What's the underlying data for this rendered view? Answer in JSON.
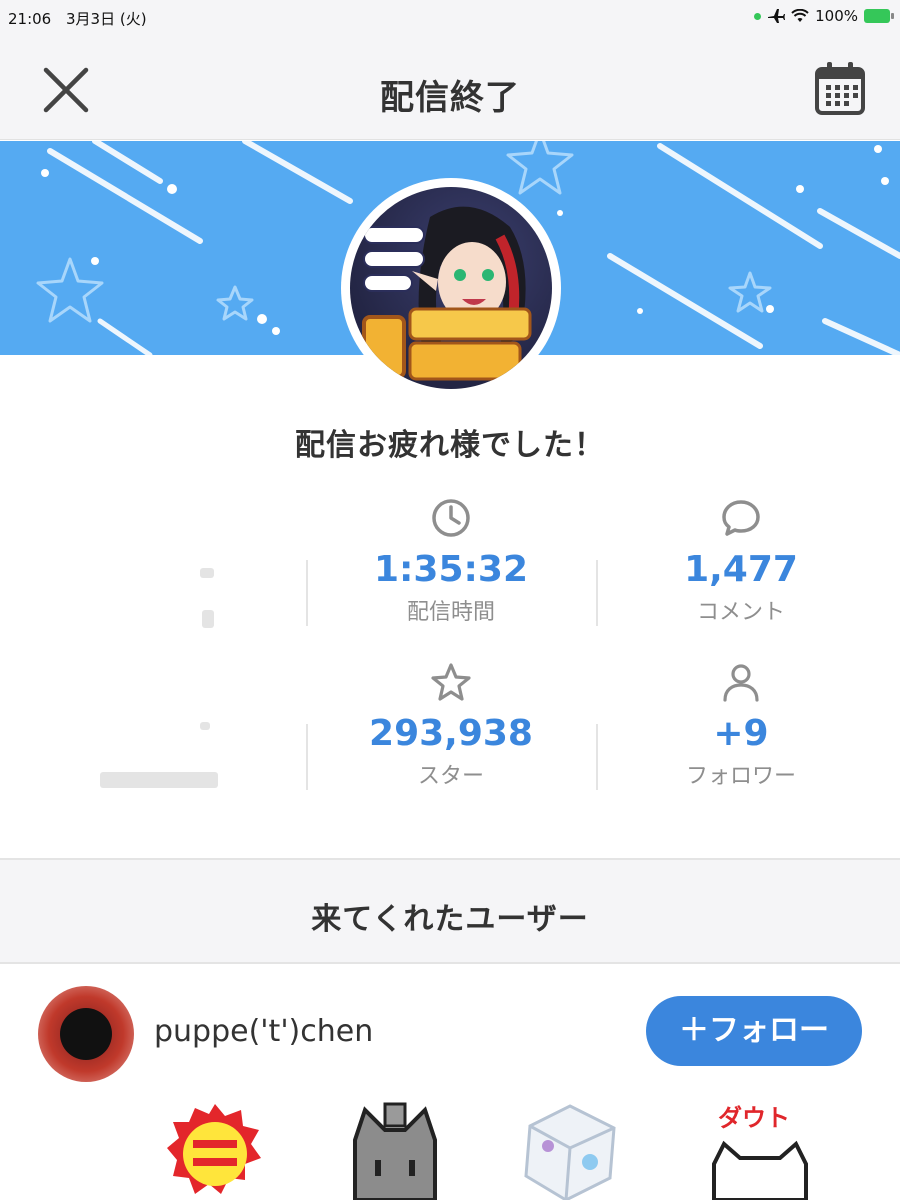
{
  "status_bar": {
    "time": "21:06",
    "date": "3月3日 (火)",
    "battery": "100%"
  },
  "nav": {
    "title": "配信終了",
    "close_icon": "close-icon",
    "calendar_icon": "calendar-icon"
  },
  "message": "配信お疲れ様でした！",
  "stats": {
    "duration": {
      "value": "1:35:32",
      "label": "配信時間",
      "icon": "clock-icon"
    },
    "comments": {
      "value": "1,477",
      "label": "コメント",
      "icon": "comment-icon"
    },
    "stars": {
      "value": "293,938",
      "label": "スター",
      "icon": "star-icon"
    },
    "followers": {
      "value": "+9",
      "label": "フォロワー",
      "icon": "person-icon"
    }
  },
  "visitors": {
    "title": "来てくれたユーザー",
    "users": [
      {
        "name": "puppe('t')chen",
        "follow_label": "＋フォロー"
      }
    ]
  },
  "colors": {
    "accent": "#3b86dd",
    "banner": "#55aaf2",
    "header_bg": "#f5f5f7"
  }
}
